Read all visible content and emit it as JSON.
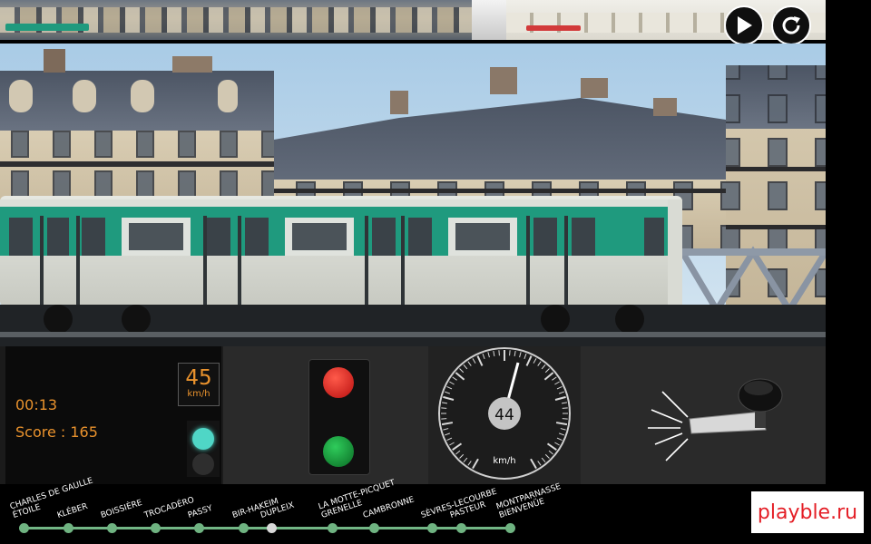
{
  "controls": {
    "play": "play-icon",
    "restart": "restart-icon"
  },
  "route_progress": 0.57,
  "stats": {
    "time": "00:13",
    "score": "Score : 165"
  },
  "speed_limit": {
    "value": "45",
    "unit": "km/h"
  },
  "speedometer": {
    "value": "44",
    "unit": "km/h",
    "speed": 44
  },
  "signal_panel": {
    "red_button": "stop-button",
    "green_button": "go-button"
  },
  "stations": [
    {
      "label": [
        "CHARLES DE GAULLE",
        "ÉTOILE"
      ],
      "passed": false
    },
    {
      "label": [
        "KLÉBER"
      ],
      "passed": false
    },
    {
      "label": [
        "BOISSIÈRE"
      ],
      "passed": false
    },
    {
      "label": [
        "TROCADÉRO"
      ],
      "passed": false
    },
    {
      "label": [
        "PASSY"
      ],
      "passed": false
    },
    {
      "label": [
        "BIR-HAKEIM"
      ],
      "passed": false
    },
    {
      "label": [
        "DUPLEIX"
      ],
      "passed": true
    },
    {
      "label": [
        "LA MOTTE-PICQUET",
        "GRENELLE"
      ],
      "passed": false
    },
    {
      "label": [
        "CAMBRONNE"
      ],
      "passed": false
    },
    {
      "label": [
        "SÈVRES-LECOURBE"
      ],
      "passed": false
    },
    {
      "label": [
        "PASTEUR"
      ],
      "passed": false
    },
    {
      "label": [
        "MONTPARNASSE",
        "BIENVENÜE"
      ],
      "passed": false
    }
  ],
  "watermark": "playble.ru",
  "colors": {
    "accent_orange": "#e9922d",
    "train_green": "#1f9a7e",
    "station_line": "#72b685",
    "lamp_on": "#4fd6c6",
    "watermark_red": "#e41e26"
  }
}
